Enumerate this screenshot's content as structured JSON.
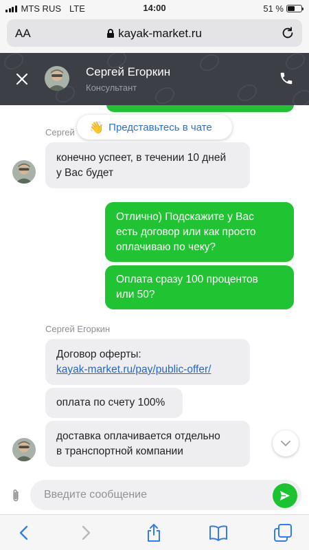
{
  "status_bar": {
    "carrier": "MTS RUS",
    "network": "LTE",
    "time": "14:00",
    "battery_text": "51 %",
    "battery_level": 0.51
  },
  "browser": {
    "text_size_label": "AA",
    "url": "kayak-market.ru"
  },
  "chat_header": {
    "agent_name": "Сергей Егоркин",
    "agent_role": "Консультант",
    "background_color": "#3d3f47"
  },
  "chat": {
    "intro_prompt": "Представьтесь в чате",
    "sender_name_top": "Сергей",
    "incoming_1": {
      "line1": "конечно успеет, в течении 10 дней",
      "line2": "у Вас будет"
    },
    "outgoing_1": {
      "line1": "Отлично) Подскажите у Вас",
      "line2": "есть договор или как просто",
      "line3": "оплачиваю по чеку?"
    },
    "outgoing_2": {
      "line1": "Оплата сразу 100 процентов",
      "line2": "или 50?"
    },
    "sender_name": "Сергей Егоркин",
    "incoming_2": {
      "line1": "Договор оферты:",
      "link": "kayak-market.ru/pay/public-offer/"
    },
    "incoming_3": "оплата по счету 100%",
    "incoming_4": {
      "line1": "доставка оплачивается отдельно",
      "line2": "в транспортной компании"
    }
  },
  "composer": {
    "placeholder": "Введите сообщение"
  },
  "colors": {
    "outgoing_bubble": "#20c331",
    "incoming_bubble": "#eeeef0",
    "link": "#2466c9",
    "ios_blue": "#2f7cf6"
  },
  "icons": {
    "close": "close-icon",
    "phone": "phone-icon",
    "attach": "paperclip-icon",
    "send": "send-icon",
    "back": "chevron-left-icon",
    "forward": "chevron-right-icon",
    "share": "share-icon",
    "bookmarks": "book-icon",
    "tabs": "tabs-icon"
  }
}
